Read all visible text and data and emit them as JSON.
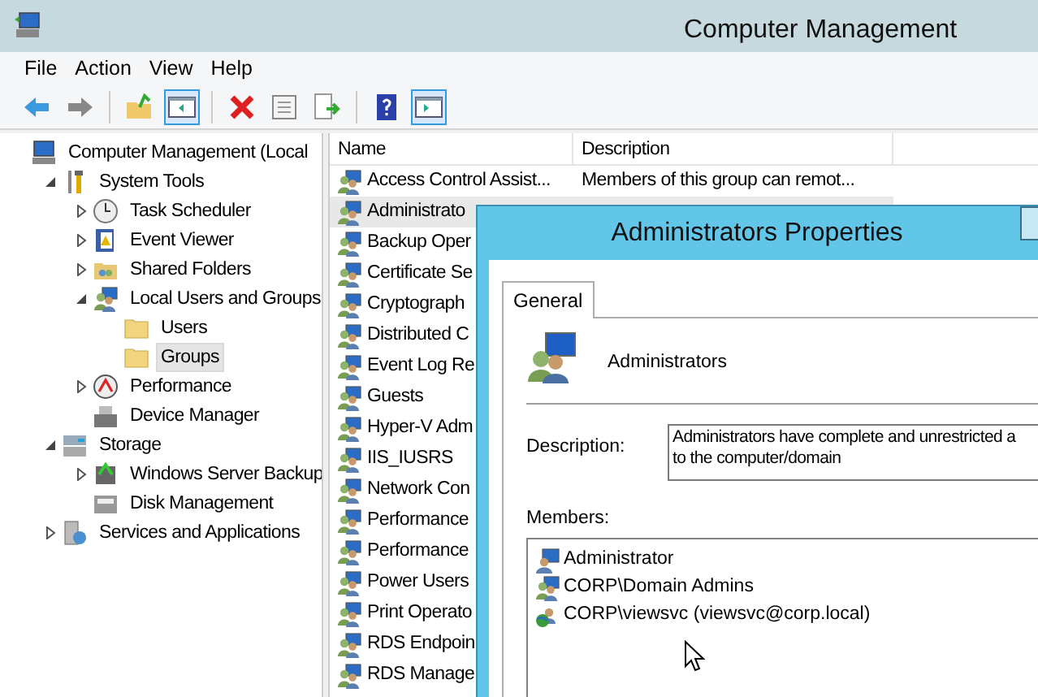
{
  "window": {
    "title": "Computer Management"
  },
  "menu": [
    "File",
    "Action",
    "View",
    "Help"
  ],
  "toolbar": [
    {
      "kind": "back",
      "pressed": false
    },
    {
      "kind": "forward",
      "pressed": false
    },
    {
      "kind": "up",
      "pressed": false,
      "separator_before": true
    },
    {
      "kind": "tree",
      "pressed": true
    },
    {
      "kind": "delete",
      "pressed": false,
      "separator_before": true
    },
    {
      "kind": "properties",
      "pressed": false
    },
    {
      "kind": "export",
      "pressed": false
    },
    {
      "kind": "help",
      "pressed": false,
      "separator_before": true
    },
    {
      "kind": "pane",
      "pressed": true
    }
  ],
  "tree": [
    {
      "label": "Computer Management (Local",
      "kind": "computer",
      "selected": false,
      "children": [
        {
          "label": "System Tools",
          "kind": "tools",
          "expanded": true,
          "selected": false,
          "children": [
            {
              "label": "Task Scheduler",
              "kind": "clock",
              "expanded": false,
              "selected": false
            },
            {
              "label": "Event Viewer",
              "kind": "log",
              "expanded": false,
              "selected": false
            },
            {
              "label": "Shared Folders",
              "kind": "share",
              "expanded": false,
              "selected": false
            },
            {
              "label": "Local Users and Groups",
              "kind": "users",
              "expanded": true,
              "selected": false,
              "children": [
                {
                  "label": "Users",
                  "kind": "folder",
                  "selected": false
                },
                {
                  "label": "Groups",
                  "kind": "folder",
                  "selected": true
                }
              ]
            },
            {
              "label": "Performance",
              "kind": "gauge",
              "expanded": false,
              "selected": false
            },
            {
              "label": "Device Manager",
              "kind": "device",
              "selected": false
            }
          ]
        },
        {
          "label": "Storage",
          "kind": "storage",
          "expanded": true,
          "selected": false,
          "children": [
            {
              "label": "Windows Server Backup",
              "kind": "backup",
              "expanded": false,
              "selected": false
            },
            {
              "label": "Disk Management",
              "kind": "disk",
              "selected": false
            }
          ]
        },
        {
          "label": "Services and Applications",
          "kind": "services",
          "expanded": false,
          "selected": false
        }
      ]
    }
  ],
  "list": {
    "columns": [
      "Name",
      "Description"
    ],
    "rows": [
      {
        "name": "Access Control Assist...",
        "description": "Members of this group can remot...",
        "selected": false
      },
      {
        "name": "Administrato",
        "selected": true
      },
      {
        "name": "Backup Oper",
        "selected": false
      },
      {
        "name": "Certificate Se",
        "selected": false
      },
      {
        "name": "Cryptograph",
        "selected": false
      },
      {
        "name": "Distributed C",
        "selected": false
      },
      {
        "name": "Event Log Re",
        "selected": false
      },
      {
        "name": "Guests",
        "selected": false
      },
      {
        "name": "Hyper-V Adm",
        "selected": false
      },
      {
        "name": "IIS_IUSRS",
        "selected": false
      },
      {
        "name": "Network Con",
        "selected": false
      },
      {
        "name": "Performance",
        "selected": false
      },
      {
        "name": "Performance",
        "selected": false
      },
      {
        "name": "Power Users",
        "selected": false
      },
      {
        "name": "Print Operato",
        "selected": false
      },
      {
        "name": "RDS Endpoin",
        "selected": false
      },
      {
        "name": "RDS Manage",
        "selected": false
      }
    ]
  },
  "dialog": {
    "title": "Administrators Properties",
    "tabs": [
      {
        "label": "General",
        "selected": true
      }
    ],
    "group_name": "Administrators",
    "description_label": "Description:",
    "description": [
      "Administrators have complete and unrestricted a",
      "to the computer/domain"
    ],
    "members_label": "Members:",
    "members": [
      {
        "name": "Administrator",
        "kind": "user"
      },
      {
        "name": "CORP\\Domain Admins",
        "kind": "group"
      },
      {
        "name": "CORP\\viewsvc (viewsvc@corp.local)",
        "kind": "domain-user"
      }
    ]
  }
}
